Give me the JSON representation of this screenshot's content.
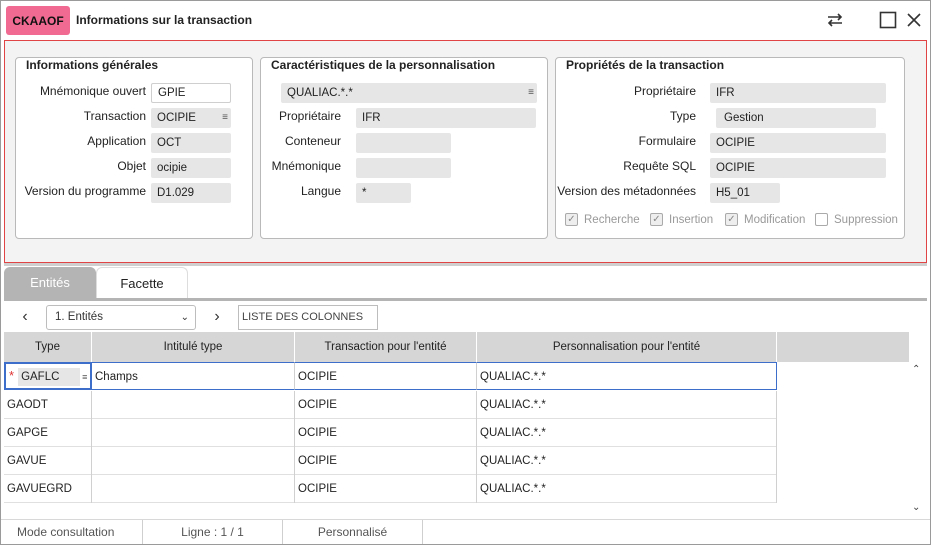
{
  "window": {
    "app_code": "CKAAOF",
    "title": "Informations sur la transaction"
  },
  "general": {
    "title": "Informations générales",
    "fields": [
      {
        "label": "Mnémonique ouvert",
        "value": "GPIE"
      },
      {
        "label": "Transaction",
        "value": "OCIPIE"
      },
      {
        "label": "Application",
        "value": "OCT"
      },
      {
        "label": "Objet",
        "value": "ocipie"
      },
      {
        "label": "Version du programme",
        "value": "D1.029"
      }
    ]
  },
  "personalization": {
    "title": "Caractéristiques de la personnalisation",
    "selector_value": "QUALIAC.*.*",
    "fields": [
      {
        "label": "Propriétaire",
        "value": "IFR"
      },
      {
        "label": "Conteneur",
        "value": ""
      },
      {
        "label": "Mnémonique",
        "value": ""
      },
      {
        "label": "Langue",
        "value": "*"
      }
    ]
  },
  "properties": {
    "title": "Propriétés de la transaction",
    "fields": [
      {
        "label": "Propriétaire",
        "value": "IFR"
      },
      {
        "label": "Type",
        "value": "Gestion"
      },
      {
        "label": "Formulaire",
        "value": "OCIPIE"
      },
      {
        "label": "Requête SQL",
        "value": "OCIPIE"
      },
      {
        "label": "Version des métadonnées",
        "value": "H5_01"
      }
    ],
    "checkboxes": [
      {
        "label": "Recherche",
        "checked": true
      },
      {
        "label": "Insertion",
        "checked": true
      },
      {
        "label": "Modification",
        "checked": true
      },
      {
        "label": "Suppression",
        "checked": false
      }
    ]
  },
  "tabs": [
    {
      "label": "Entités",
      "active": true
    },
    {
      "label": "Facette",
      "active": false
    }
  ],
  "toolbar": {
    "entity_select": "1. Entités",
    "columns_placeholder": "LISTE DES COLONNES"
  },
  "table": {
    "columns": [
      "Type",
      "Intitulé type",
      "Transaction pour l'entité",
      "Personnalisation pour l'entité"
    ],
    "rows": [
      {
        "type": "GAFLC",
        "label": "Champs",
        "transaction": "OCIPIE",
        "perso": "QUALIAC.*.*",
        "selected": true
      },
      {
        "type": "GAODT",
        "label": "",
        "transaction": "OCIPIE",
        "perso": "QUALIAC.*.*"
      },
      {
        "type": "GAPGE",
        "label": "",
        "transaction": "OCIPIE",
        "perso": "QUALIAC.*.*"
      },
      {
        "type": "GAVUE",
        "label": "",
        "transaction": "OCIPIE",
        "perso": "QUALIAC.*.*"
      },
      {
        "type": "GAVUEGRD",
        "label": "",
        "transaction": "OCIPIE",
        "perso": "QUALIAC.*.*"
      }
    ]
  },
  "status": {
    "mode": "Mode consultation",
    "line": "Ligne : 1 / 1",
    "custom": "Personnalisé"
  },
  "icons": {
    "swap": "swap-arrows-icon",
    "maximize": "maximize-icon",
    "close": "close-icon",
    "list": "list-icon",
    "required": "asterisk-icon"
  },
  "colors": {
    "accent": "#f06a91",
    "highlight_border": "#e14444",
    "tab_active": "#b4b4b4",
    "selection": "#3d6ec9"
  }
}
